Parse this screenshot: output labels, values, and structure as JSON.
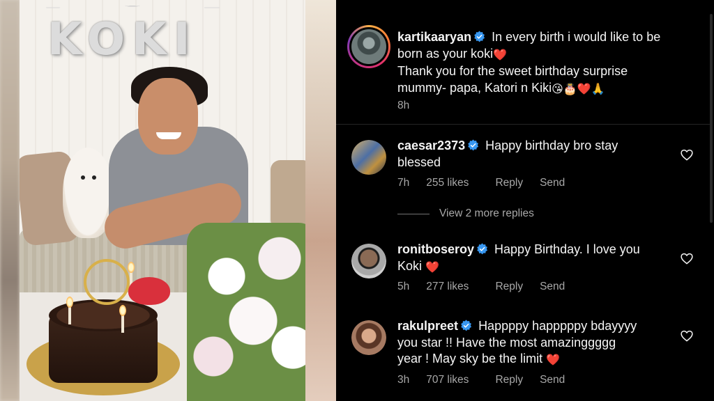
{
  "photo": {
    "balloon_letters": "KOKI"
  },
  "post": {
    "username": "kartikaaryan",
    "caption_line1": "In every birth i would like to be",
    "caption_line2": "born as your koki",
    "caption_line3": "Thank you for the sweet birthday surprise",
    "caption_line4": "mummy- papa, Katori n Kiki",
    "caption_emojis": "😘🎂❤️🙏",
    "heart_emoji": "❤️",
    "time": "8h"
  },
  "comments": [
    {
      "username": "caesar2373",
      "text_line1": "Happy birthday bro stay",
      "text_line2": "blessed",
      "time": "7h",
      "likes": "255 likes",
      "reply_label": "Reply",
      "send_label": "Send"
    },
    {
      "username": "ronitboseroy",
      "text_line1": "Happy Birthday. I love you",
      "text_line2": "Koki",
      "heart_emoji": "❤️",
      "time": "5h",
      "likes": "277 likes",
      "reply_label": "Reply",
      "send_label": "Send"
    },
    {
      "username": "rakulpreet",
      "text_line1": "Happppy happpppy bdayyyy",
      "text_line2": "you star !! Have the most amazinggggg",
      "text_line3": "year ! May sky be the limit",
      "heart_emoji": "❤️",
      "time": "3h",
      "likes": "707 likes",
      "reply_label": "Reply",
      "send_label": "Send"
    }
  ],
  "view_replies_label": "View 2 more replies",
  "colors": {
    "verified_blue": "#3897f0",
    "heart_red": "#ed4956",
    "muted_text": "#a8a8a8"
  }
}
